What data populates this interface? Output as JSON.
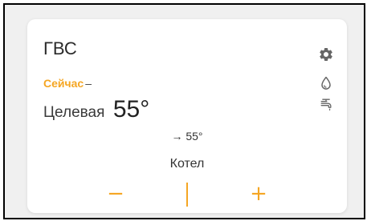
{
  "widget": {
    "title": "ГВС",
    "now_label": "Сейчас",
    "now_value": "–",
    "target_label": "Целевая",
    "target_value": "55°",
    "setpoint_text": "→ 55°",
    "source_label": "Котел",
    "minus_label": "−",
    "plus_label": "+"
  },
  "icons": {
    "settings": "gear-icon",
    "water": "water-drop-icon",
    "tap": "tap-icon"
  },
  "colors": {
    "accent": "#f5a623",
    "text": "#2b2b2b",
    "icon": "#666666",
    "background": "#f0f0f0",
    "card": "#ffffff"
  }
}
